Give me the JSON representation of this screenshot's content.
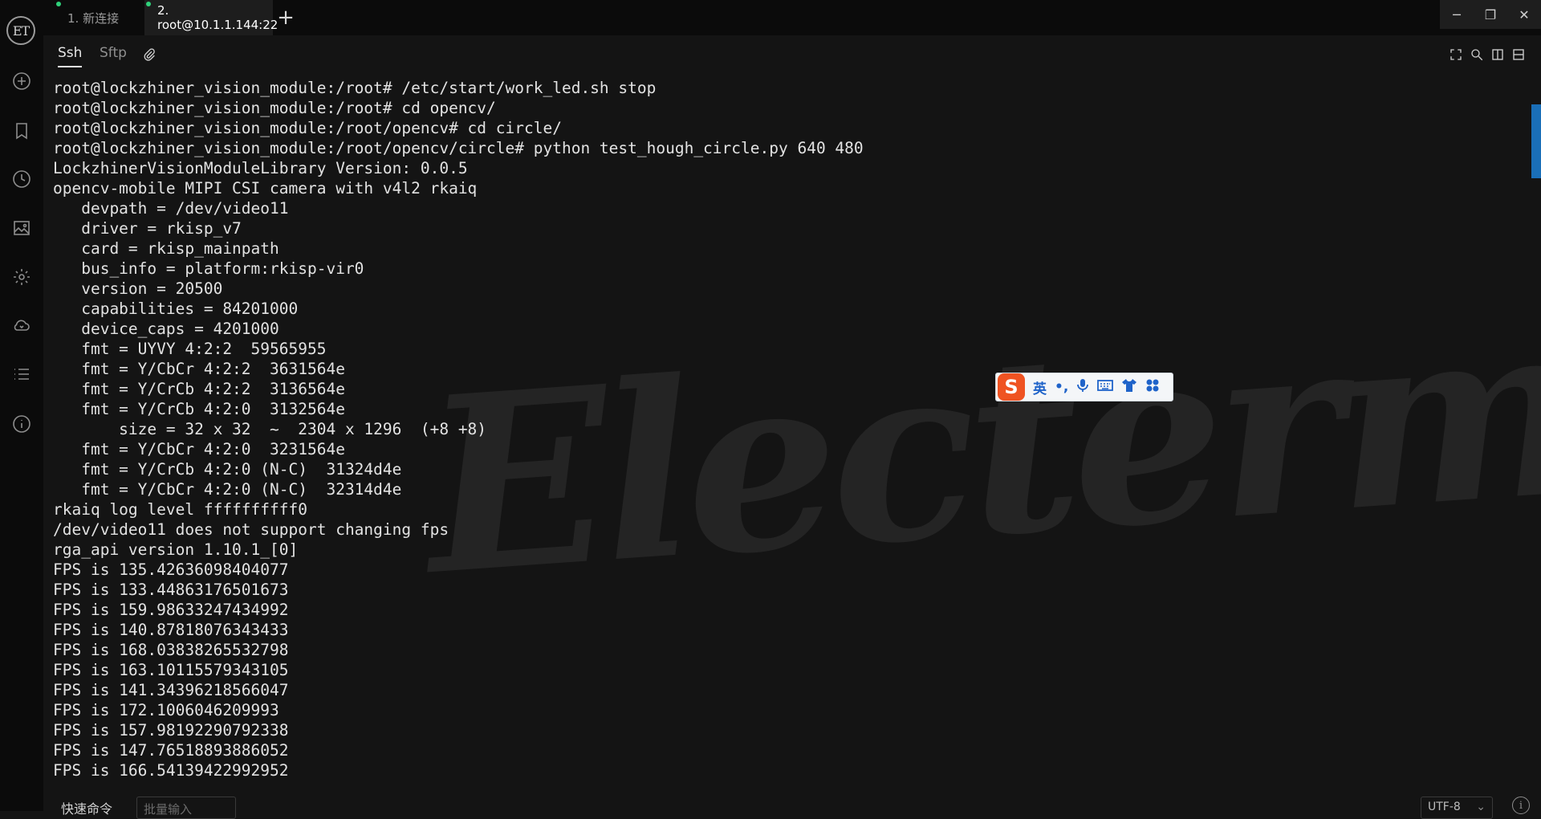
{
  "sidebar": {
    "logo_text": "ET",
    "icons": [
      "add-circle-icon",
      "bookmark-icon",
      "history-icon",
      "image-icon",
      "settings-icon",
      "cloud-sync-icon",
      "list-icon",
      "info-icon"
    ]
  },
  "tabs": [
    {
      "label": "1. 新连接",
      "active": false
    },
    {
      "label": "2. root@10.1.1.144:22",
      "active": true
    }
  ],
  "tab_add_label": "+",
  "window_controls": {
    "minimize": "─",
    "restore": "❐",
    "close": "✕"
  },
  "subtabs": [
    {
      "label": "Ssh",
      "active": true
    },
    {
      "label": "Sftp",
      "active": false
    }
  ],
  "terminal": {
    "watermark": "Electerm",
    "lines": [
      "root@lockzhiner_vision_module:/root# /etc/start/work_led.sh stop",
      "root@lockzhiner_vision_module:/root# cd opencv/",
      "root@lockzhiner_vision_module:/root/opencv# cd circle/",
      "root@lockzhiner_vision_module:/root/opencv/circle# python test_hough_circle.py 640 480",
      "LockzhinerVisionModuleLibrary Version: 0.0.5",
      "opencv-mobile MIPI CSI camera with v4l2 rkaiq",
      "   devpath = /dev/video11",
      "   driver = rkisp_v7",
      "   card = rkisp_mainpath",
      "   bus_info = platform:rkisp-vir0",
      "   version = 20500",
      "   capabilities = 84201000",
      "   device_caps = 4201000",
      "   fmt = UYVY 4:2:2  59565955",
      "   fmt = Y/CbCr 4:2:2  3631564e",
      "   fmt = Y/CrCb 4:2:2  3136564e",
      "   fmt = Y/CrCb 4:2:0  3132564e",
      "       size = 32 x 32  ~  2304 x 1296  (+8 +8)",
      "   fmt = Y/CbCr 4:2:0  3231564e",
      "   fmt = Y/CrCb 4:2:0 (N-C)  31324d4e",
      "   fmt = Y/CbCr 4:2:0 (N-C)  32314d4e",
      "rkaiq log level ffffffffff0",
      "/dev/video11 does not support changing fps",
      "rga_api version 1.10.1_[0]",
      "FPS is 135.42636098404077",
      "FPS is 133.44863176501673",
      "FPS is 159.98633247434992",
      "FPS is 140.87818076343433",
      "FPS is 168.03838265532798",
      "FPS is 163.10115579343105",
      "FPS is 141.34396218566047",
      "FPS is 172.1006046209993",
      "FPS is 157.98192290792338",
      "FPS is 147.76518893886052",
      "FPS is 166.54139422992952"
    ]
  },
  "ime": {
    "logo": "S",
    "lang": "英",
    "punct": "•,"
  },
  "bottom": {
    "quick_command": "快速命令",
    "batch_placeholder": "批量输入",
    "encoding": "UTF-8"
  }
}
